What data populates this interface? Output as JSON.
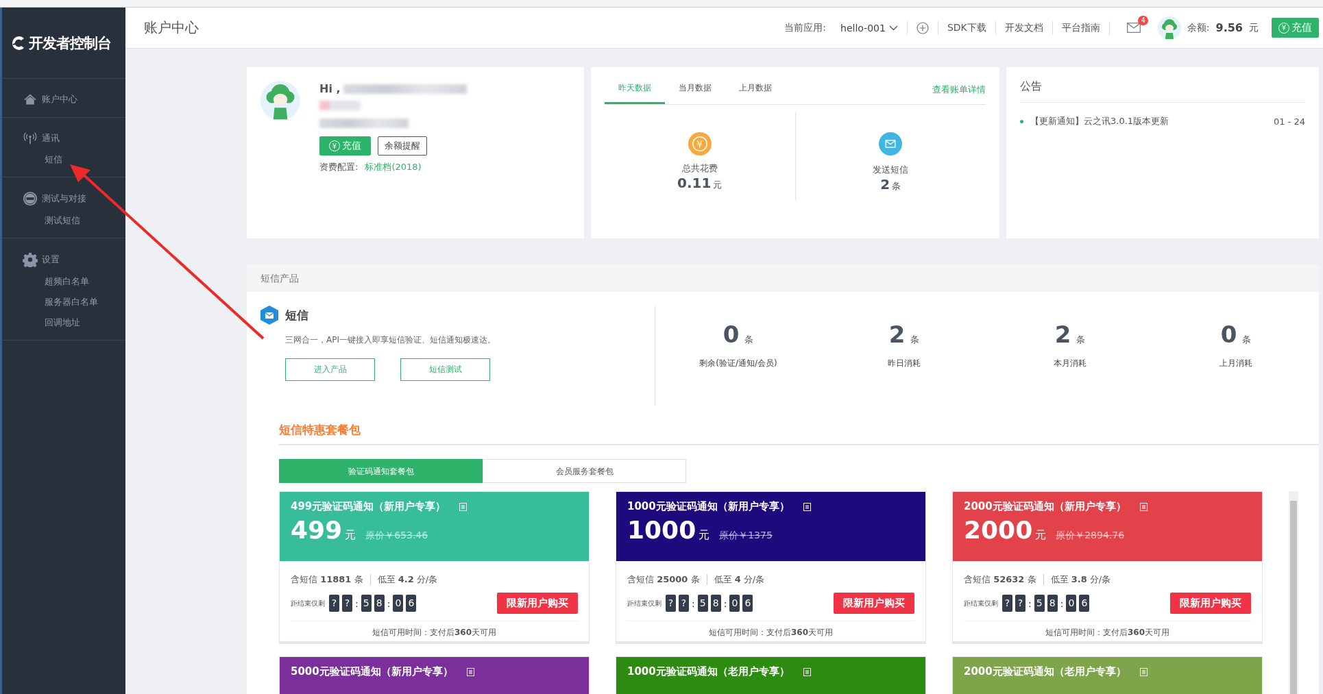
{
  "sidebar": {
    "logo": "开发者控制台",
    "groups": [
      {
        "kind": "home",
        "title": "账户中心"
      },
      {
        "kind": "antenna",
        "title": "通讯",
        "items": [
          "短信"
        ]
      },
      {
        "kind": "test",
        "title": "测试与对接",
        "items": [
          "测试短信"
        ]
      },
      {
        "kind": "gear",
        "title": "设置",
        "items": [
          "超频白名单",
          "服务器白名单",
          "回调地址"
        ]
      }
    ]
  },
  "header": {
    "title": "账户中心",
    "app_label": "当前应用:",
    "app_value": "hello-001",
    "links": [
      "SDK下载",
      "开发文档",
      "平台指南"
    ],
    "mail_badge": "4",
    "balance_label": "余额:",
    "balance_value": "9.56",
    "balance_unit": "元",
    "recharge": "充值",
    "recharge_icon": "¥"
  },
  "profile": {
    "greeting": "Hi ,",
    "recharge": "充值",
    "recharge_icon": "¥",
    "reminder": "余额提醒",
    "plan_label": "资费配置:",
    "plan_value": "标准档(2018)"
  },
  "data_card": {
    "tabs": [
      {
        "label": "昨天数据",
        "selected": true
      },
      {
        "label": "当月数据",
        "selected": false
      },
      {
        "label": "上月数据",
        "selected": false
      }
    ],
    "link": "查看账单详情",
    "metrics": [
      {
        "kind": "coin",
        "icon_text": "¥",
        "label": "总共花费",
        "value": "0.11",
        "unit": "元"
      },
      {
        "kind": "mail",
        "label": "发送短信",
        "value": "2",
        "unit": "条"
      }
    ]
  },
  "notice": {
    "title": "公告",
    "items": [
      {
        "text": "【更新通知】云之讯3.0.1版本更新",
        "date": "01 - 24"
      }
    ]
  },
  "product": {
    "section_title": "短信产品",
    "name": "短信",
    "description": "三网合一，API一键接入即享短信验证、短信通知极速达。",
    "buttons": [
      "进入产品",
      "短信测试"
    ],
    "stats": [
      {
        "value": "0",
        "unit": "条",
        "label": "剩余(验证/通知/会员)"
      },
      {
        "value": "2",
        "unit": "条",
        "label": "昨日消耗"
      },
      {
        "value": "2",
        "unit": "条",
        "label": "本月消耗"
      },
      {
        "value": "0",
        "unit": "条",
        "label": "上月消耗"
      }
    ]
  },
  "packages": {
    "title": "短信特惠套餐包",
    "tabs": [
      {
        "label": "验证码通知套餐包",
        "selected": true
      },
      {
        "label": "会员服务套餐包",
        "selected": false
      }
    ],
    "cards": [
      {
        "title": "499元验证码通知（新用户专享）",
        "color": "#37bd9a",
        "price": "499",
        "unit": "元",
        "original": "原价￥653.46",
        "contains": "含短信 **11881** 条",
        "low": "低至 **4.2** 分/条",
        "countdown_label": "距结束仅剩",
        "countdown": [
          "?",
          "?",
          ":",
          "5",
          "8",
          ":",
          "0",
          "6"
        ],
        "buy": "限新用户购买",
        "validity": "短信可用时间：支付后**360**天可用"
      },
      {
        "title": "1000元验证码通知（新用户专享）",
        "color": "#1e0a7d",
        "price": "1000",
        "unit": "元",
        "original": "原价￥1375",
        "contains": "含短信 **25000** 条",
        "low": "低至 **4** 分/条",
        "countdown_label": "距结束仅剩",
        "countdown": [
          "?",
          "?",
          ":",
          "5",
          "8",
          ":",
          "0",
          "6"
        ],
        "buy": "限新用户购买",
        "validity": "短信可用时间：支付后**360**天可用"
      },
      {
        "title": "2000元验证码通知（新用户专享）",
        "color": "#e2434a",
        "price": "2000",
        "unit": "元",
        "original": "原价￥2894.76",
        "contains": "含短信 **52632** 条",
        "low": "低至 **3.8** 分/条",
        "countdown_label": "距结束仅剩",
        "countdown": [
          "?",
          "?",
          ":",
          "5",
          "8",
          ":",
          "0",
          "6"
        ],
        "buy": "限新用户购买",
        "validity": "短信可用时间：支付后**360**天可用"
      },
      {
        "title": "5000元验证码通知（新用户专享）",
        "color": "#7a2f9a"
      },
      {
        "title": "1000元验证码通知（老用户专享）",
        "color": "#2e8b12"
      },
      {
        "title": "2000元验证码通知（老用户专享）",
        "color": "#7ea54a"
      }
    ]
  }
}
